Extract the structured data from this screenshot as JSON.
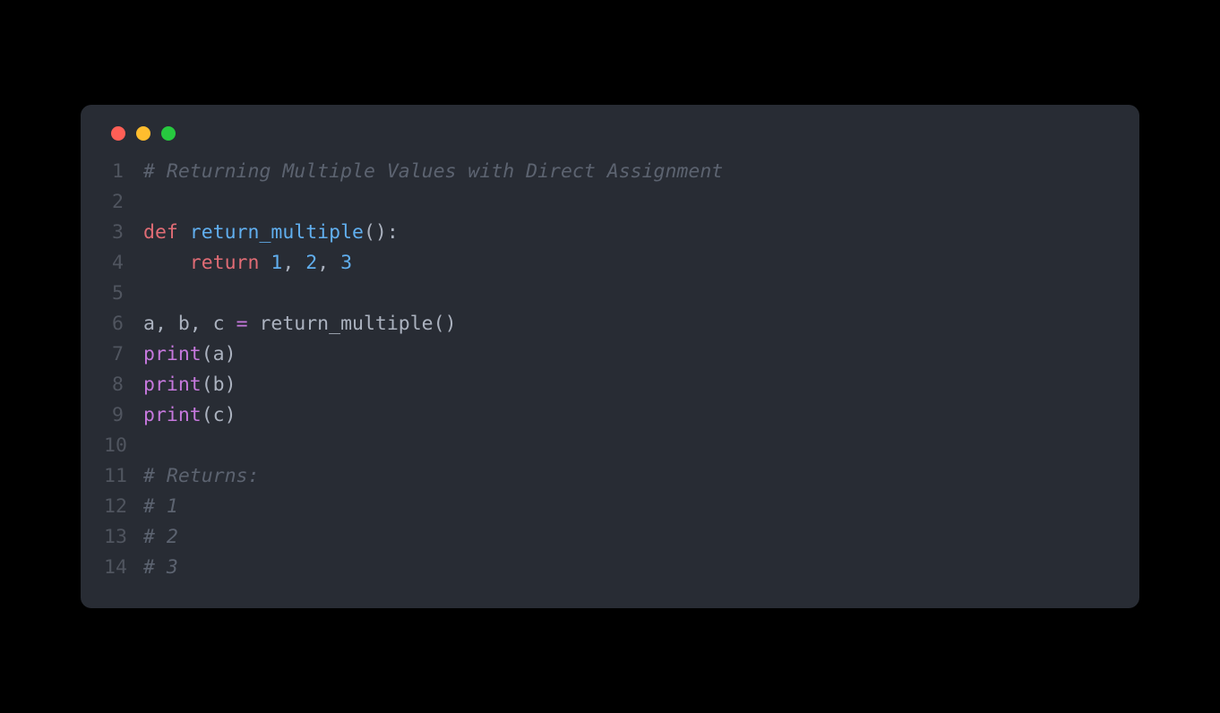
{
  "window": {
    "traffic_lights": [
      "close",
      "minimize",
      "zoom"
    ]
  },
  "code": {
    "lines": [
      {
        "n": "1",
        "tokens": [
          {
            "cls": "comment",
            "t": "# Returning Multiple Values with Direct Assignment"
          }
        ]
      },
      {
        "n": "2",
        "tokens": []
      },
      {
        "n": "3",
        "tokens": [
          {
            "cls": "def-kw",
            "t": "def"
          },
          {
            "cls": "plain",
            "t": " "
          },
          {
            "cls": "funcname",
            "t": "return_multiple"
          },
          {
            "cls": "plain",
            "t": "():"
          }
        ]
      },
      {
        "n": "4",
        "tokens": [
          {
            "cls": "plain",
            "t": "    "
          },
          {
            "cls": "def-kw",
            "t": "return"
          },
          {
            "cls": "plain",
            "t": " "
          },
          {
            "cls": "num",
            "t": "1"
          },
          {
            "cls": "plain",
            "t": ", "
          },
          {
            "cls": "num",
            "t": "2"
          },
          {
            "cls": "plain",
            "t": ", "
          },
          {
            "cls": "num",
            "t": "3"
          }
        ]
      },
      {
        "n": "5",
        "tokens": []
      },
      {
        "n": "6",
        "tokens": [
          {
            "cls": "plain",
            "t": "a, b, c "
          },
          {
            "cls": "keyword",
            "t": "="
          },
          {
            "cls": "plain",
            "t": " return_multiple()"
          }
        ]
      },
      {
        "n": "7",
        "tokens": [
          {
            "cls": "builtin",
            "t": "print"
          },
          {
            "cls": "plain",
            "t": "(a)"
          }
        ]
      },
      {
        "n": "8",
        "tokens": [
          {
            "cls": "builtin",
            "t": "print"
          },
          {
            "cls": "plain",
            "t": "(b)"
          }
        ]
      },
      {
        "n": "9",
        "tokens": [
          {
            "cls": "builtin",
            "t": "print"
          },
          {
            "cls": "plain",
            "t": "(c)"
          }
        ]
      },
      {
        "n": "10",
        "tokens": []
      },
      {
        "n": "11",
        "tokens": [
          {
            "cls": "comment",
            "t": "# Returns:"
          }
        ]
      },
      {
        "n": "12",
        "tokens": [
          {
            "cls": "comment",
            "t": "# 1"
          }
        ]
      },
      {
        "n": "13",
        "tokens": [
          {
            "cls": "comment",
            "t": "# 2"
          }
        ]
      },
      {
        "n": "14",
        "tokens": [
          {
            "cls": "comment",
            "t": "# 3"
          }
        ]
      }
    ]
  }
}
